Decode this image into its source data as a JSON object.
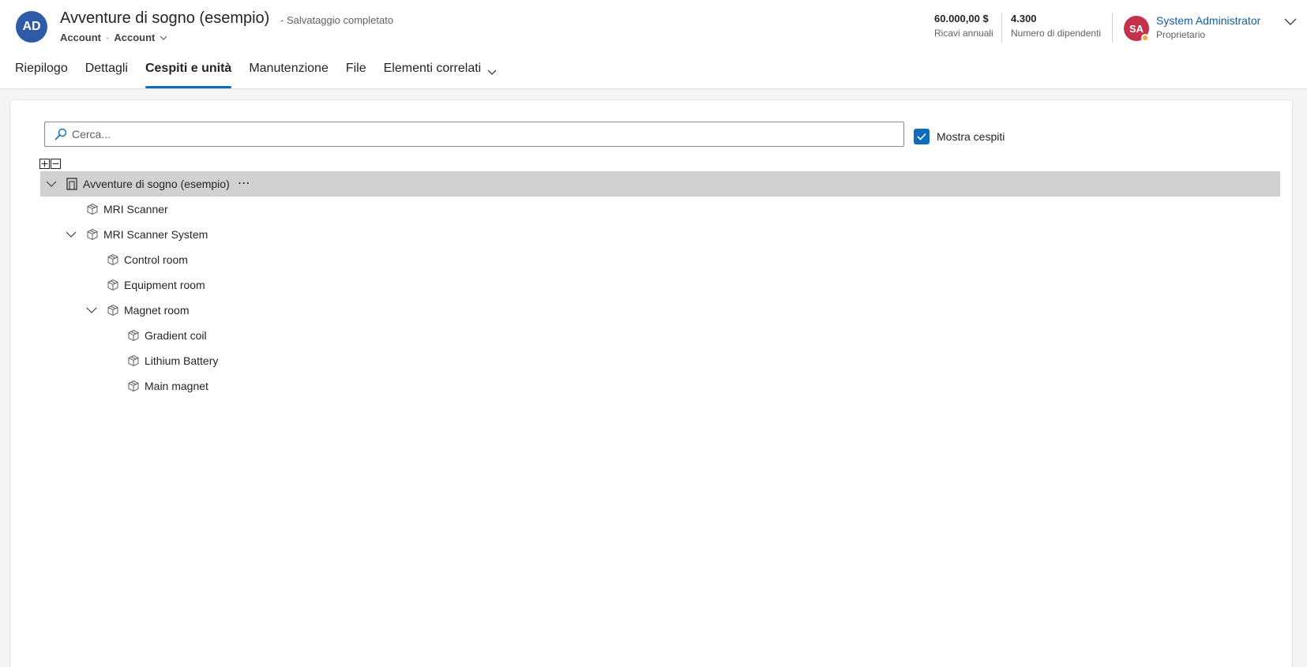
{
  "record": {
    "initials": "AD",
    "title": "Avventure di sogno (esempio)",
    "save_status": "- Salvataggio completato",
    "entity": "Account",
    "form": "Account"
  },
  "kpis": [
    {
      "value": "60.000,00 $",
      "label": "Ricavi annuali"
    },
    {
      "value": "4.300",
      "label": "Numero di dipendenti"
    }
  ],
  "owner": {
    "initials": "SA",
    "name": "System Administrator",
    "role": "Proprietario",
    "presence_color": "#f8a23c"
  },
  "tabs": [
    {
      "label": "Riepilogo",
      "active": false
    },
    {
      "label": "Dettagli",
      "active": false
    },
    {
      "label": "Cespiti e unità",
      "active": true
    },
    {
      "label": "Manutenzione",
      "active": false
    },
    {
      "label": "File",
      "active": false
    },
    {
      "label": "Elementi correlati",
      "active": false,
      "has_dropdown": true
    }
  ],
  "search": {
    "placeholder": "Cerca..."
  },
  "show_assets": {
    "label": "Mostra cespiti",
    "checked": true
  },
  "tree": {
    "root": {
      "label": "Avventure di sogno (esempio)",
      "icon": "account-icon",
      "expanded": true
    },
    "nodes": [
      {
        "label": "MRI Scanner",
        "icon": "asset-cube-icon",
        "level": 1,
        "has_children": false
      },
      {
        "label": "MRI Scanner System",
        "icon": "asset-cube-icon",
        "level": 1,
        "has_children": true,
        "expanded": true
      },
      {
        "label": "Control room",
        "icon": "asset-cube-icon",
        "level": 2,
        "has_children": false
      },
      {
        "label": "Equipment room",
        "icon": "asset-cube-icon",
        "level": 2,
        "has_children": false
      },
      {
        "label": "Magnet room",
        "icon": "asset-cube-icon",
        "level": 2,
        "has_children": true,
        "expanded": true
      },
      {
        "label": "Gradient coil",
        "icon": "asset-cube-icon",
        "level": 3,
        "has_children": false
      },
      {
        "label": "Lithium Battery",
        "icon": "asset-cube-icon",
        "level": 3,
        "has_children": false
      },
      {
        "label": "Main magnet",
        "icon": "asset-cube-icon",
        "level": 3,
        "has_children": false
      }
    ]
  },
  "colors": {
    "accent": "#0f6cbd",
    "avatar_record": "#2f5aa8",
    "avatar_owner": "#c4314b",
    "link": "#115ea3",
    "selected_row": "#d1d1d1"
  }
}
